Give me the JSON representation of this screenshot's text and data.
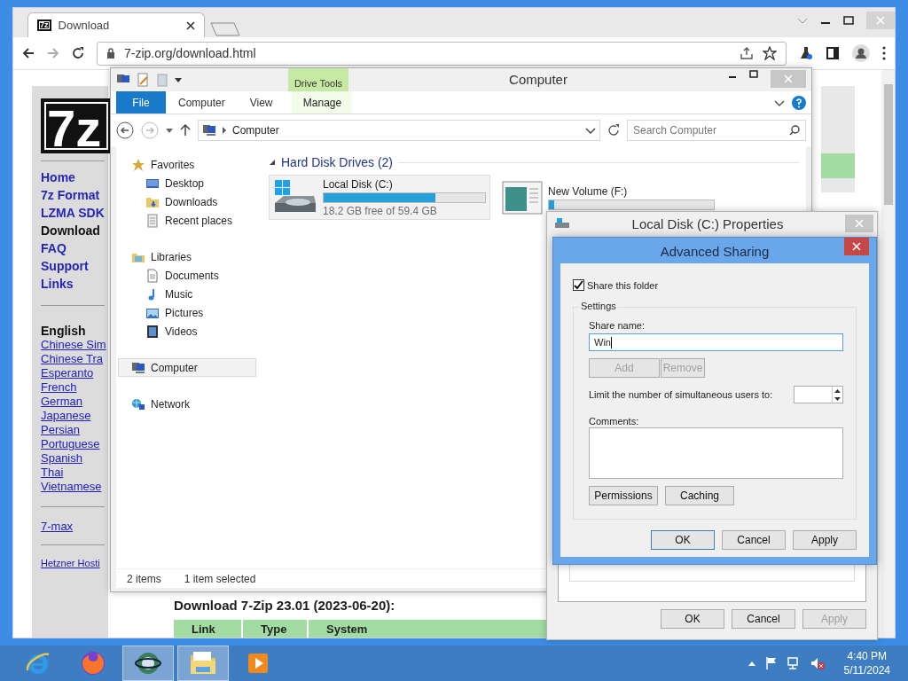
{
  "browser": {
    "tab": {
      "favicon": "7z",
      "title": "Download"
    },
    "url": "7-zip.org/download.html",
    "page": {
      "logo": "7z",
      "nav": [
        {
          "label": "Home",
          "selected": false
        },
        {
          "label": "7z Format",
          "selected": false
        },
        {
          "label": "LZMA SDK",
          "selected": false
        },
        {
          "label": "Download",
          "selected": true
        },
        {
          "label": "FAQ",
          "selected": false
        },
        {
          "label": "Support",
          "selected": false
        },
        {
          "label": "Links",
          "selected": false
        }
      ],
      "languages": [
        {
          "label": "English",
          "selected": true
        },
        {
          "label": "Chinese Sim",
          "selected": false
        },
        {
          "label": "Chinese Tra",
          "selected": false
        },
        {
          "label": "Esperanto",
          "selected": false
        },
        {
          "label": "French",
          "selected": false
        },
        {
          "label": "German",
          "selected": false
        },
        {
          "label": "Japanese",
          "selected": false
        },
        {
          "label": "Persian",
          "selected": false
        },
        {
          "label": "Portuguese",
          "selected": false
        },
        {
          "label": "Spanish",
          "selected": false
        },
        {
          "label": "Thai",
          "selected": false
        },
        {
          "label": "Vietnamese",
          "selected": false
        }
      ],
      "other_links": [
        "7-max"
      ],
      "sponsor_link": "Hetzner Hosti",
      "heading": "Download 7-Zip 23.01 (2023-06-20):",
      "table_columns": [
        "Link",
        "Type",
        "System"
      ]
    }
  },
  "explorer": {
    "title": "Computer",
    "contextual_group": "Drive Tools",
    "ribbon_tabs": [
      {
        "label": "File",
        "kind": "file"
      },
      {
        "label": "Computer",
        "kind": "plain"
      },
      {
        "label": "View",
        "kind": "plain"
      },
      {
        "label": "Manage",
        "kind": "contextual"
      }
    ],
    "address": "Computer",
    "search_placeholder": "Search Computer",
    "nav": [
      {
        "label": "Favorites",
        "kind": "star",
        "selected": false,
        "children": [
          {
            "label": "Desktop",
            "kind": "desktop",
            "selected": false
          },
          {
            "label": "Downloads",
            "kind": "downloads",
            "selected": false
          },
          {
            "label": "Recent places",
            "kind": "recent",
            "selected": false
          }
        ]
      },
      {
        "label": "Libraries",
        "kind": "libraries",
        "selected": false,
        "children": [
          {
            "label": "Documents",
            "kind": "documents",
            "selected": false
          },
          {
            "label": "Music",
            "kind": "music",
            "selected": false
          },
          {
            "label": "Pictures",
            "kind": "pictures",
            "selected": false
          },
          {
            "label": "Videos",
            "kind": "videos",
            "selected": false
          }
        ]
      },
      {
        "label": "Computer",
        "kind": "computer",
        "selected": true
      },
      {
        "label": "Network",
        "kind": "network",
        "selected": false
      }
    ],
    "section": "Hard Disk Drives (2)",
    "drives": [
      {
        "name": "Local Disk (C:)",
        "kind": "system",
        "selected": true,
        "level": 0.69,
        "caption": "18.2 GB free of 59.4 GB"
      },
      {
        "name": "New Volume (F:)",
        "kind": "volume",
        "selected": false,
        "level": 0.03
      }
    ],
    "status": [
      "2 items",
      "1 item selected"
    ]
  },
  "properties": {
    "title": "Local Disk (C:) Properties",
    "buttons": [
      {
        "label": "OK",
        "disabled": false
      },
      {
        "label": "Cancel",
        "disabled": false
      },
      {
        "label": "Apply",
        "disabled": true
      }
    ]
  },
  "advanced_sharing": {
    "title": "Advanced Sharing",
    "share_checkbox": {
      "label": "Share this folder",
      "checked": true
    },
    "group": "Settings",
    "share_name_label": "Share name:",
    "share_name": "Win",
    "name_buttons": [
      {
        "label": "Add",
        "disabled": true
      },
      {
        "label": "Remove",
        "disabled": true
      }
    ],
    "limit_label": "Limit the number of simultaneous users to:",
    "comments_label": "Comments:",
    "option_buttons": [
      {
        "label": "Permissions",
        "disabled": false
      },
      {
        "label": "Caching",
        "disabled": false
      }
    ],
    "buttons": [
      {
        "label": "OK",
        "default": true
      },
      {
        "label": "Cancel",
        "default": false
      },
      {
        "label": "Apply",
        "default": false
      }
    ]
  },
  "taskbar": {
    "apps": [
      {
        "kind": "ie",
        "running": false
      },
      {
        "kind": "firefox",
        "running": false
      },
      {
        "kind": "globe",
        "running": true
      },
      {
        "kind": "folder",
        "running": true
      },
      {
        "kind": "media",
        "running": false
      }
    ],
    "time": "4:40 PM",
    "date": "5/11/2024"
  }
}
